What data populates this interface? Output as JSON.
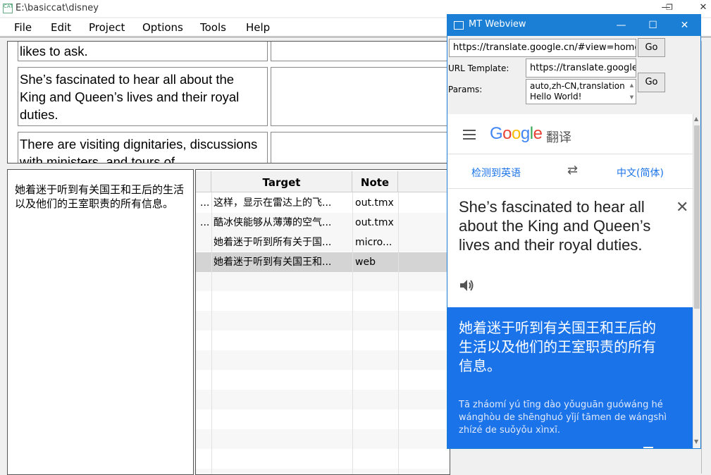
{
  "window": {
    "title": "E:\\basiccat\\disney"
  },
  "menu": [
    "File",
    "Edit",
    "Project",
    "Options",
    "Tools",
    "Help"
  ],
  "source_segments": [
    "likes to ask.",
    "She’s fascinated to hear all about the King and Queen’s lives and their royal duties.",
    "There are visiting dignitaries, discussions with ministers, and tours of"
  ],
  "editor": {
    "text": "她着迷于听到有关国王和王后的生活以及他们的王室职责的所有信息。"
  },
  "tm_table": {
    "headers": {
      "target": "Target",
      "note": "Note"
    },
    "rows": [
      {
        "marker": "...",
        "target": "这样，显示在雷达上的飞...",
        "note": "out.tmx"
      },
      {
        "marker": "...",
        "target": "酷冰侠能够从薄薄的空气...",
        "note": "out.tmx"
      },
      {
        "marker": "",
        "target": "她着迷于听到所有关于国...",
        "note": "micro..."
      },
      {
        "marker": "",
        "target": "她着迷于听到有关国王和...",
        "note": "web"
      }
    ]
  },
  "mt_webview": {
    "title": "MT Webview",
    "url": "https://translate.google.cn/#view=home&op",
    "go_label": "Go",
    "url_template_label": "URL Template:",
    "url_template": "https://translate.google.c",
    "params_label": "Params:",
    "params_line1": "auto,zh-CN,translation",
    "params_line2": "Hello World!",
    "google": {
      "logo": "Google",
      "logo_suffix": "翻译",
      "source_lang": "检测到英语",
      "swap": "⇄",
      "target_lang": "中文(简体)",
      "source_text": "She’s fascinated to hear all about the King and Queen’s lives and their royal duties.",
      "result_text": "她着迷于听到有关国王和王后的生活以及他们的王室职责的所有信息。",
      "pinyin": "Tā zháomí yú tīng dào yǒuguān guówáng hé wánghòu de shēnghuó yǐjí tāmen de wángshì zhízé de suǒyǒu xìnxī.",
      "accent_color": "#1a73e8"
    }
  }
}
